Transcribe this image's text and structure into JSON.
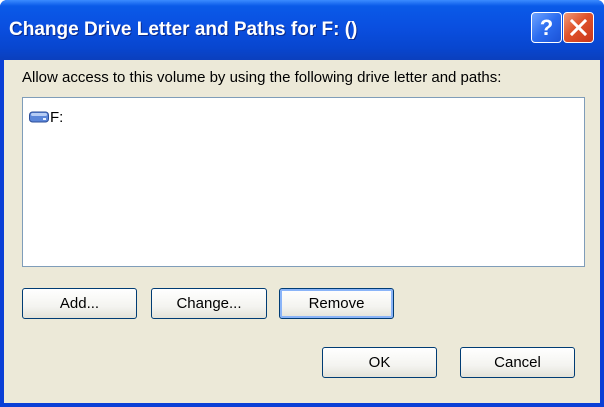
{
  "window": {
    "title": "Change Drive Letter and Paths for F: ()",
    "help_label": "?",
    "icons": {
      "help": "help-icon",
      "close": "close-icon",
      "drive": "drive-icon"
    }
  },
  "dialog": {
    "instruction": "Allow access to this volume by using the following drive letter and paths:",
    "list_items": [
      {
        "label": "F:",
        "icon": "drive-icon"
      }
    ],
    "buttons": {
      "add": "Add...",
      "change": "Change...",
      "remove": "Remove",
      "ok": "OK",
      "cancel": "Cancel"
    }
  },
  "colors": {
    "titlebar": "#0a4fe0",
    "client_bg": "#ece9d8",
    "close_button": "#e0532b",
    "list_border": "#7f9db9"
  }
}
